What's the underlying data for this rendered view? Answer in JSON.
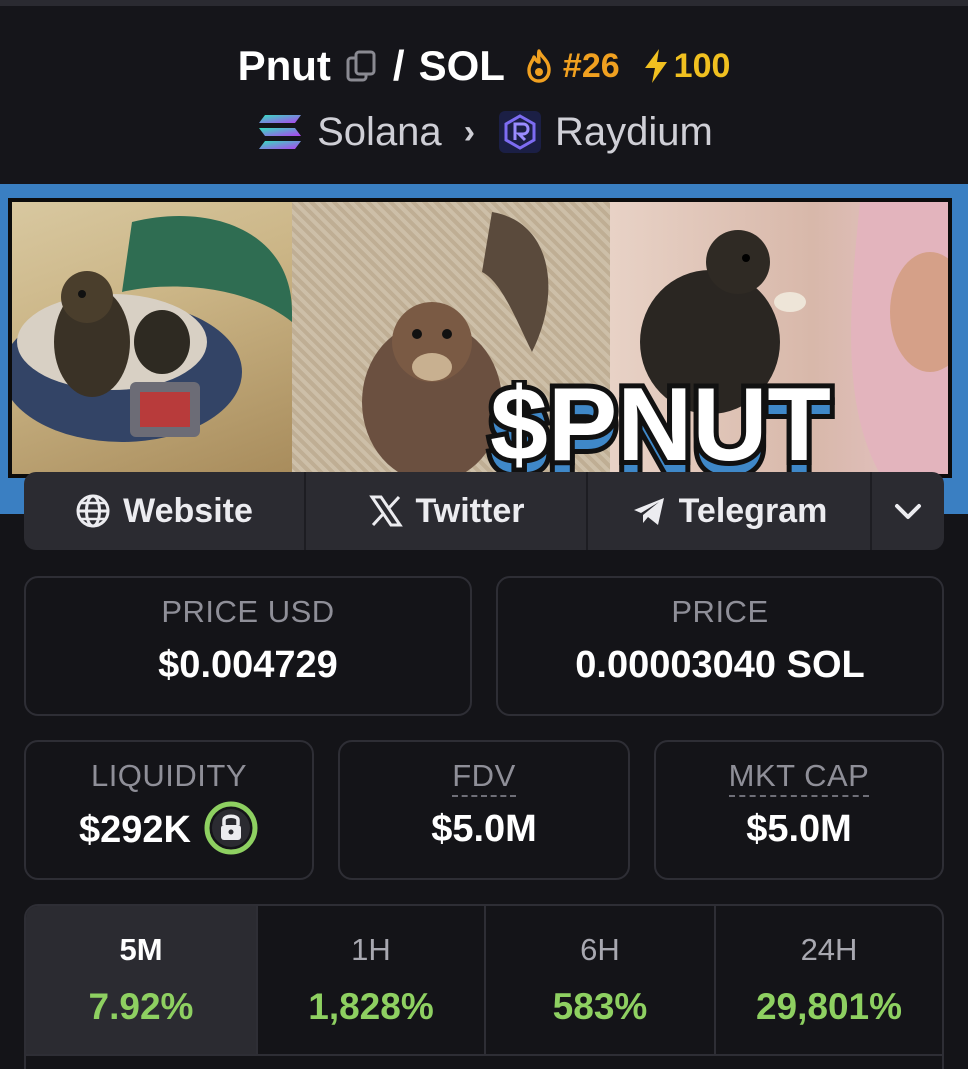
{
  "header": {
    "token_symbol": "Pnut",
    "separator": "/",
    "quote_symbol": "SOL",
    "trending_rank": "#26",
    "boost_count": "100",
    "chain": "Solana",
    "dex": "Raydium",
    "icons": {
      "copy": "copy-icon",
      "trending": "fire-icon",
      "boost": "lightning-bolt-icon",
      "chain": "solana-logo-icon",
      "dex": "raydium-logo-icon",
      "breadcrumb": "chevron-right-icon"
    }
  },
  "banner": {
    "text": "$PNUT",
    "description_alt": "banner"
  },
  "links": [
    {
      "label": "Website",
      "icon": "globe-icon"
    },
    {
      "label": "Twitter",
      "icon": "x-logo-icon"
    },
    {
      "label": "Telegram",
      "icon": "telegram-icon"
    }
  ],
  "links_more_icon": "chevron-down-icon",
  "stats": {
    "price_usd_label": "PRICE USD",
    "price_usd_value": "$0.004729",
    "price_label": "PRICE",
    "price_value": "0.00003040 SOL",
    "liquidity_label": "LIQUIDITY",
    "liquidity_value": "$292K",
    "fdv_label": "FDV",
    "fdv_value": "$5.0M",
    "mkt_cap_label": "MKT CAP",
    "mkt_cap_value": "$5.0M"
  },
  "periods": [
    {
      "label": "5M",
      "value": "7.92%",
      "active": true
    },
    {
      "label": "1H",
      "value": "1,828%",
      "active": false
    },
    {
      "label": "6H",
      "value": "583%",
      "active": false
    },
    {
      "label": "24H",
      "value": "29,801%",
      "active": false
    }
  ],
  "colors": {
    "background": "#141418",
    "card_border": "#2e2e35",
    "positive": "#8ed061",
    "rank": "#f0a020",
    "boost": "#f0c020",
    "banner_frame": "#3a7fc2"
  }
}
